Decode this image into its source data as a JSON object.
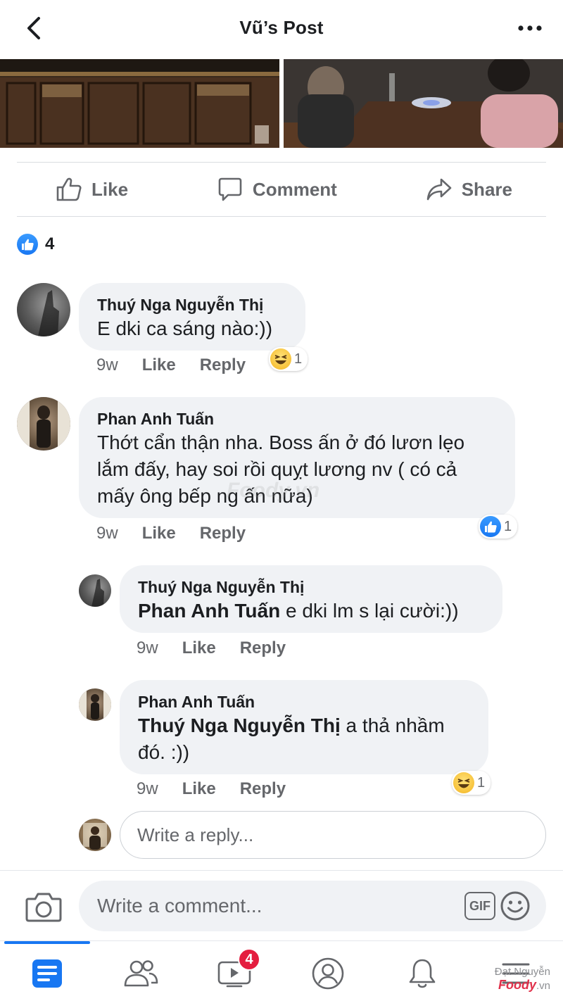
{
  "header": {
    "title": "Vũ’s Post"
  },
  "actions": {
    "like": "Like",
    "comment": "Comment",
    "share": "Share"
  },
  "reactions": {
    "count": "4"
  },
  "comments": [
    {
      "author": "Thuý Nga Nguyễn Thị",
      "text": "E dki ca sáng nào:))",
      "time": "9w",
      "like_label": "Like",
      "reply_label": "Reply",
      "reaction": {
        "type": "haha",
        "count": "1"
      }
    },
    {
      "author": "Phan Anh Tuấn",
      "text": "Thớt cẩn thận nha. Boss ấn ở đó lươn lẹo lắm đấy, hay soi rồi quỵt lương nv ( có cả mấy ông bếp ng ấn nữa)",
      "time": "9w",
      "like_label": "Like",
      "reply_label": "Reply",
      "reaction": {
        "type": "like",
        "count": "1"
      },
      "replies": [
        {
          "author": "Thuý Nga Nguyễn Thị",
          "mention": "Phan Anh Tuấn",
          "text": " e dki lm s lại cười:))",
          "time": "9w",
          "like_label": "Like",
          "reply_label": "Reply"
        },
        {
          "author": "Phan Anh Tuấn",
          "mention": "Thuý Nga Nguyễn Thị",
          "text": " a thả nhầm đó. :))",
          "time": "9w",
          "like_label": "Like",
          "reply_label": "Reply",
          "reaction": {
            "type": "haha",
            "count": "1"
          }
        }
      ]
    }
  ],
  "reply_input": {
    "placeholder": "Write a reply..."
  },
  "composer": {
    "placeholder": "Write a comment...",
    "gif_label": "GIF"
  },
  "nav": {
    "video_badge": "4"
  },
  "watermark": {
    "name": "Đạt Nguyễn",
    "brand": "Foody",
    "domain": ".vn",
    "overlay": "Foody.vn"
  },
  "icons": [
    "back-icon",
    "more-icon",
    "like-icon",
    "comment-icon",
    "share-icon",
    "camera-icon",
    "gif-icon",
    "emoji-icon",
    "news-feed-icon",
    "friends-icon",
    "watch-icon",
    "profile-icon",
    "bell-icon",
    "menu-icon"
  ],
  "colors": {
    "accent": "#1877f2",
    "badge": "#e41e3f",
    "bubble": "#f0f2f5",
    "secondary_text": "#65676b"
  }
}
